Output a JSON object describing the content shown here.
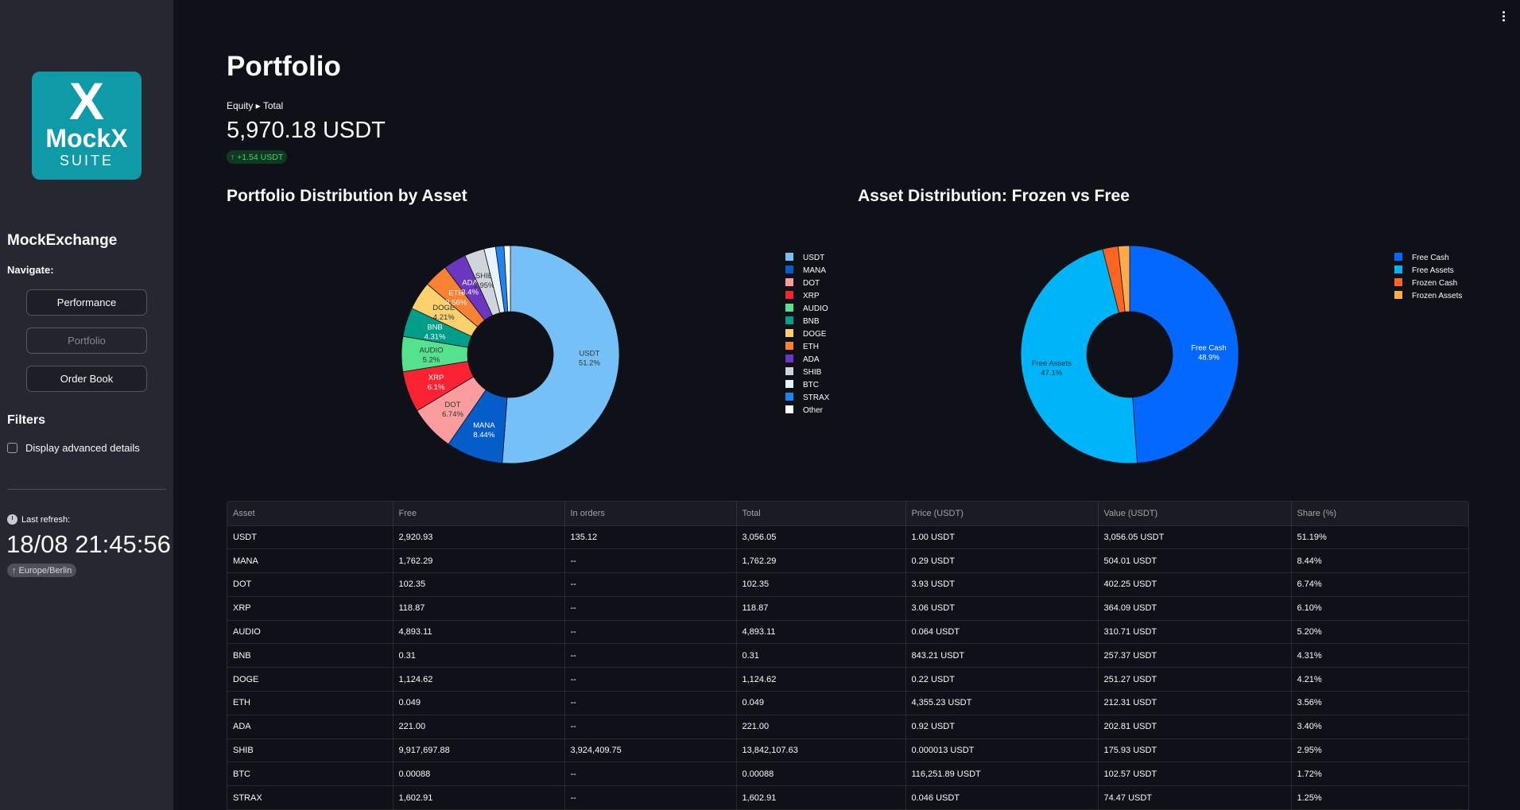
{
  "sidebar": {
    "logo": {
      "mark": "X",
      "name": "MockX",
      "suite": "SUITE"
    },
    "app_title": "MockExchange",
    "nav_label": "Navigate:",
    "nav_buttons": [
      "Performance",
      "Portfolio",
      "Order Book"
    ],
    "filters_title": "Filters",
    "advanced_label": "Display advanced details",
    "refresh_label": "Last refresh:",
    "refresh_time": "18/08 21:45:56",
    "timezone": "↑ Europe/Berlin"
  },
  "main": {
    "title": "Portfolio",
    "metric_label": "Equity ▸ Total",
    "metric_value": "5,970.18 USDT",
    "metric_delta": "↑ +1.54 USDT"
  },
  "chart_data": [
    {
      "type": "pie",
      "title": "Portfolio Distribution by Asset",
      "hole": true,
      "legend": "right",
      "labels": [
        "USDT",
        "MANA",
        "DOT",
        "XRP",
        "AUDIO",
        "BNB",
        "DOGE",
        "ETH",
        "ADA",
        "SHIB",
        "BTC",
        "STRAX",
        "Other"
      ],
      "values": [
        51.19,
        8.44,
        6.74,
        6.1,
        5.2,
        4.31,
        4.21,
        3.56,
        3.4,
        2.95,
        1.72,
        1.25,
        0.93
      ],
      "slice_labels": [
        "51.2%",
        "8.44%",
        "6.74%",
        "6.1%",
        "5.2%",
        "4.31%",
        "4.21%",
        "3.56%",
        "3.4%",
        "2.95%",
        "",
        "",
        ""
      ],
      "colors": [
        "#75c1f7",
        "#045dc8",
        "#fb9c9f",
        "#fb2232",
        "#55e28e",
        "#009e89",
        "#fbd06d",
        "#f98232",
        "#6c37c0",
        "#d0d4db",
        "#e8f3fd",
        "#1e84ef",
        "#ffffff"
      ]
    },
    {
      "type": "pie",
      "title": "Asset Distribution: Frozen vs Free",
      "hole": true,
      "legend": "right",
      "labels": [
        "Free Cash",
        "Free Assets",
        "Frozen Cash",
        "Frozen Assets"
      ],
      "values": [
        48.9,
        47.1,
        2.3,
        1.7
      ],
      "slice_labels": [
        "48.9%",
        "47.1%",
        "",
        ""
      ],
      "colors": [
        "#0368ff",
        "#00b4f9",
        "#fb6421",
        "#feab4a"
      ]
    }
  ],
  "table": {
    "headers": [
      "Asset",
      "Free",
      "In orders",
      "Total",
      "Price (USDT)",
      "Value (USDT)",
      "Share (%)"
    ],
    "rows": [
      [
        "USDT",
        "2,920.93",
        "135.12",
        "3,056.05",
        "1.00 USDT",
        "3,056.05 USDT",
        "51.19%"
      ],
      [
        "MANA",
        "1,762.29",
        "--",
        "1,762.29",
        "0.29 USDT",
        "504.01 USDT",
        "8.44%"
      ],
      [
        "DOT",
        "102.35",
        "--",
        "102.35",
        "3.93 USDT",
        "402.25 USDT",
        "6.74%"
      ],
      [
        "XRP",
        "118.87",
        "--",
        "118.87",
        "3.06 USDT",
        "364.09 USDT",
        "6.10%"
      ],
      [
        "AUDIO",
        "4,893.11",
        "--",
        "4,893.11",
        "0.064 USDT",
        "310.71 USDT",
        "5.20%"
      ],
      [
        "BNB",
        "0.31",
        "--",
        "0.31",
        "843.21 USDT",
        "257.37 USDT",
        "4.31%"
      ],
      [
        "DOGE",
        "1,124.62",
        "--",
        "1,124.62",
        "0.22 USDT",
        "251.27 USDT",
        "4.21%"
      ],
      [
        "ETH",
        "0.049",
        "--",
        "0.049",
        "4,355.23 USDT",
        "212.31 USDT",
        "3.56%"
      ],
      [
        "ADA",
        "221.00",
        "--",
        "221.00",
        "0.92 USDT",
        "202.81 USDT",
        "3.40%"
      ],
      [
        "SHIB",
        "9,917,697.88",
        "3,924,409.75",
        "13,842,107.63",
        "0.000013 USDT",
        "175.93 USDT",
        "2.95%"
      ],
      [
        "BTC",
        "0.00088",
        "--",
        "0.00088",
        "116,251.89 USDT",
        "102.57 USDT",
        "1.72%"
      ],
      [
        "STRAX",
        "1,602.91",
        "--",
        "1,602.91",
        "0.046 USDT",
        "74.47 USDT",
        "1.25%"
      ]
    ]
  }
}
